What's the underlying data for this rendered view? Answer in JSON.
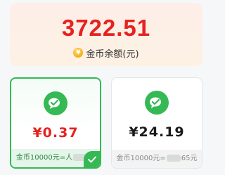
{
  "balance": {
    "amount": "3722.51",
    "label": "金币余额(元)",
    "icon": "coin-icon",
    "amount_color": "#e6221f"
  },
  "options": [
    {
      "amount": "¥0.37",
      "rate_prefix": "金币10000元=人",
      "rate_suffix": "元",
      "selected": true,
      "icon": "wechat-pay-icon"
    },
    {
      "amount": "¥24.19",
      "rate_prefix": "金币10000元=",
      "rate_suffix": "65元",
      "selected": false,
      "icon": "wechat-pay-icon"
    }
  ],
  "accent_color": "#35b954"
}
